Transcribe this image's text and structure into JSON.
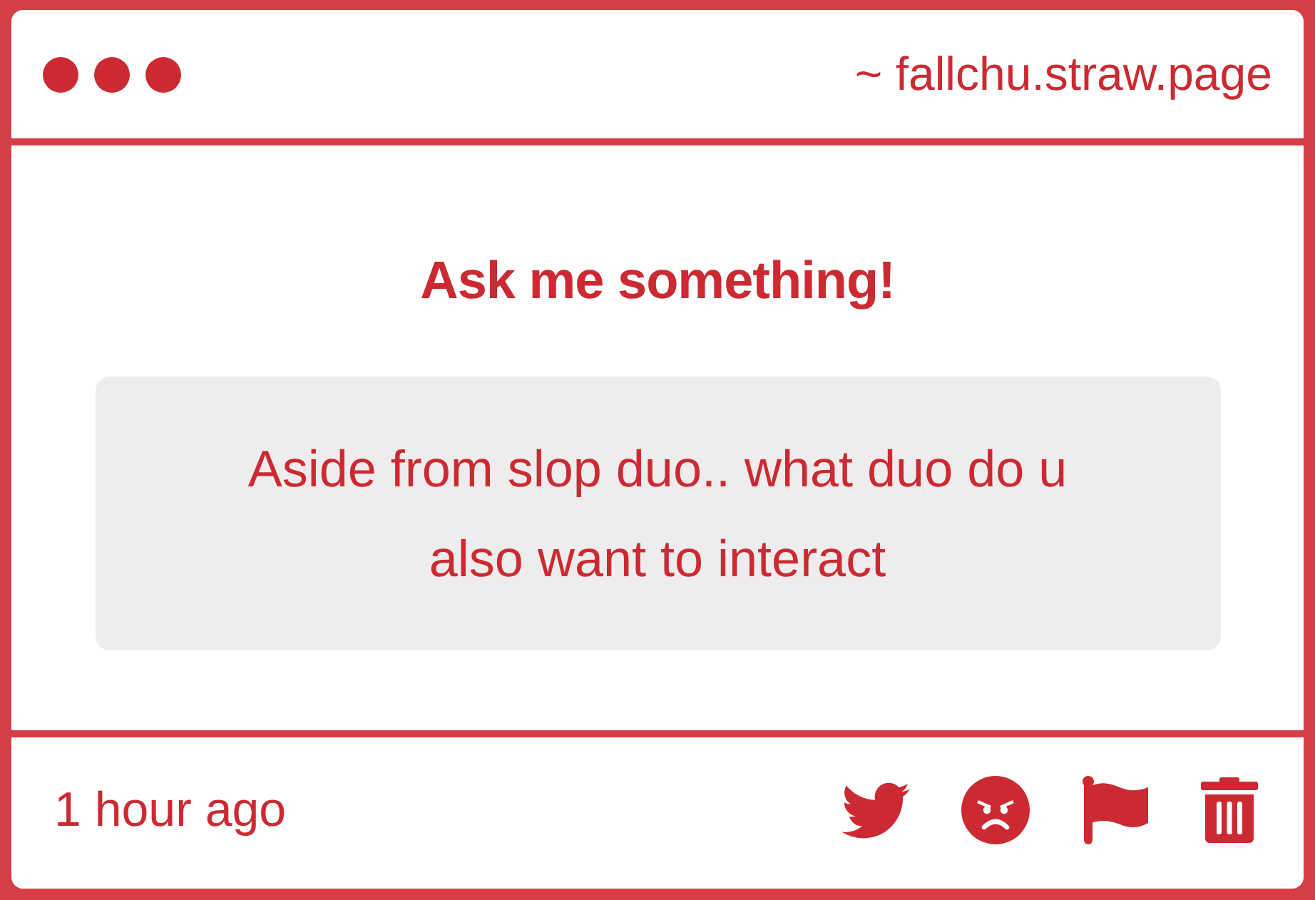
{
  "window": {
    "address": "~ fallchu.straw.page"
  },
  "heading": "Ask me something!",
  "question": "Aside from slop duo.. what duo do u also want to interact",
  "footer": {
    "time": "1 hour ago",
    "actions": [
      {
        "kind": "tweet"
      },
      {
        "kind": "react"
      },
      {
        "kind": "report"
      },
      {
        "kind": "delete"
      }
    ]
  }
}
